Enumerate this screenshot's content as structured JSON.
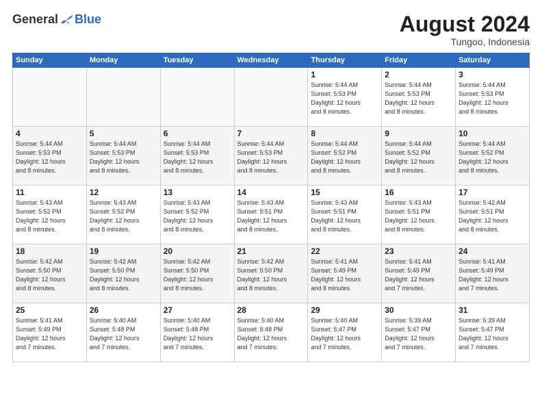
{
  "header": {
    "logo_general": "General",
    "logo_blue": "Blue",
    "month_title": "August 2024",
    "subtitle": "Tungoo, Indonesia"
  },
  "weekdays": [
    "Sunday",
    "Monday",
    "Tuesday",
    "Wednesday",
    "Thursday",
    "Friday",
    "Saturday"
  ],
  "weeks": [
    [
      {
        "day": "",
        "info": ""
      },
      {
        "day": "",
        "info": ""
      },
      {
        "day": "",
        "info": ""
      },
      {
        "day": "",
        "info": ""
      },
      {
        "day": "1",
        "info": "Sunrise: 5:44 AM\nSunset: 5:53 PM\nDaylight: 12 hours\nand 8 minutes."
      },
      {
        "day": "2",
        "info": "Sunrise: 5:44 AM\nSunset: 5:53 PM\nDaylight: 12 hours\nand 8 minutes."
      },
      {
        "day": "3",
        "info": "Sunrise: 5:44 AM\nSunset: 5:53 PM\nDaylight: 12 hours\nand 8 minutes."
      }
    ],
    [
      {
        "day": "4",
        "info": "Sunrise: 5:44 AM\nSunset: 5:53 PM\nDaylight: 12 hours\nand 8 minutes."
      },
      {
        "day": "5",
        "info": "Sunrise: 5:44 AM\nSunset: 5:53 PM\nDaylight: 12 hours\nand 8 minutes."
      },
      {
        "day": "6",
        "info": "Sunrise: 5:44 AM\nSunset: 5:53 PM\nDaylight: 12 hours\nand 8 minutes."
      },
      {
        "day": "7",
        "info": "Sunrise: 5:44 AM\nSunset: 5:53 PM\nDaylight: 12 hours\nand 8 minutes."
      },
      {
        "day": "8",
        "info": "Sunrise: 5:44 AM\nSunset: 5:52 PM\nDaylight: 12 hours\nand 8 minutes."
      },
      {
        "day": "9",
        "info": "Sunrise: 5:44 AM\nSunset: 5:52 PM\nDaylight: 12 hours\nand 8 minutes."
      },
      {
        "day": "10",
        "info": "Sunrise: 5:44 AM\nSunset: 5:52 PM\nDaylight: 12 hours\nand 8 minutes."
      }
    ],
    [
      {
        "day": "11",
        "info": "Sunrise: 5:43 AM\nSunset: 5:52 PM\nDaylight: 12 hours\nand 8 minutes."
      },
      {
        "day": "12",
        "info": "Sunrise: 5:43 AM\nSunset: 5:52 PM\nDaylight: 12 hours\nand 8 minutes."
      },
      {
        "day": "13",
        "info": "Sunrise: 5:43 AM\nSunset: 5:52 PM\nDaylight: 12 hours\nand 8 minutes."
      },
      {
        "day": "14",
        "info": "Sunrise: 5:43 AM\nSunset: 5:51 PM\nDaylight: 12 hours\nand 8 minutes."
      },
      {
        "day": "15",
        "info": "Sunrise: 5:43 AM\nSunset: 5:51 PM\nDaylight: 12 hours\nand 8 minutes."
      },
      {
        "day": "16",
        "info": "Sunrise: 5:43 AM\nSunset: 5:51 PM\nDaylight: 12 hours\nand 8 minutes."
      },
      {
        "day": "17",
        "info": "Sunrise: 5:42 AM\nSunset: 5:51 PM\nDaylight: 12 hours\nand 8 minutes."
      }
    ],
    [
      {
        "day": "18",
        "info": "Sunrise: 5:42 AM\nSunset: 5:50 PM\nDaylight: 12 hours\nand 8 minutes."
      },
      {
        "day": "19",
        "info": "Sunrise: 5:42 AM\nSunset: 5:50 PM\nDaylight: 12 hours\nand 8 minutes."
      },
      {
        "day": "20",
        "info": "Sunrise: 5:42 AM\nSunset: 5:50 PM\nDaylight: 12 hours\nand 8 minutes."
      },
      {
        "day": "21",
        "info": "Sunrise: 5:42 AM\nSunset: 5:50 PM\nDaylight: 12 hours\nand 8 minutes."
      },
      {
        "day": "22",
        "info": "Sunrise: 5:41 AM\nSunset: 5:49 PM\nDaylight: 12 hours\nand 8 minutes."
      },
      {
        "day": "23",
        "info": "Sunrise: 5:41 AM\nSunset: 5:49 PM\nDaylight: 12 hours\nand 7 minutes."
      },
      {
        "day": "24",
        "info": "Sunrise: 5:41 AM\nSunset: 5:49 PM\nDaylight: 12 hours\nand 7 minutes."
      }
    ],
    [
      {
        "day": "25",
        "info": "Sunrise: 5:41 AM\nSunset: 5:49 PM\nDaylight: 12 hours\nand 7 minutes."
      },
      {
        "day": "26",
        "info": "Sunrise: 5:40 AM\nSunset: 5:48 PM\nDaylight: 12 hours\nand 7 minutes."
      },
      {
        "day": "27",
        "info": "Sunrise: 5:40 AM\nSunset: 5:48 PM\nDaylight: 12 hours\nand 7 minutes."
      },
      {
        "day": "28",
        "info": "Sunrise: 5:40 AM\nSunset: 5:48 PM\nDaylight: 12 hours\nand 7 minutes."
      },
      {
        "day": "29",
        "info": "Sunrise: 5:40 AM\nSunset: 5:47 PM\nDaylight: 12 hours\nand 7 minutes."
      },
      {
        "day": "30",
        "info": "Sunrise: 5:39 AM\nSunset: 5:47 PM\nDaylight: 12 hours\nand 7 minutes."
      },
      {
        "day": "31",
        "info": "Sunrise: 5:39 AM\nSunset: 5:47 PM\nDaylight: 12 hours\nand 7 minutes."
      }
    ]
  ]
}
